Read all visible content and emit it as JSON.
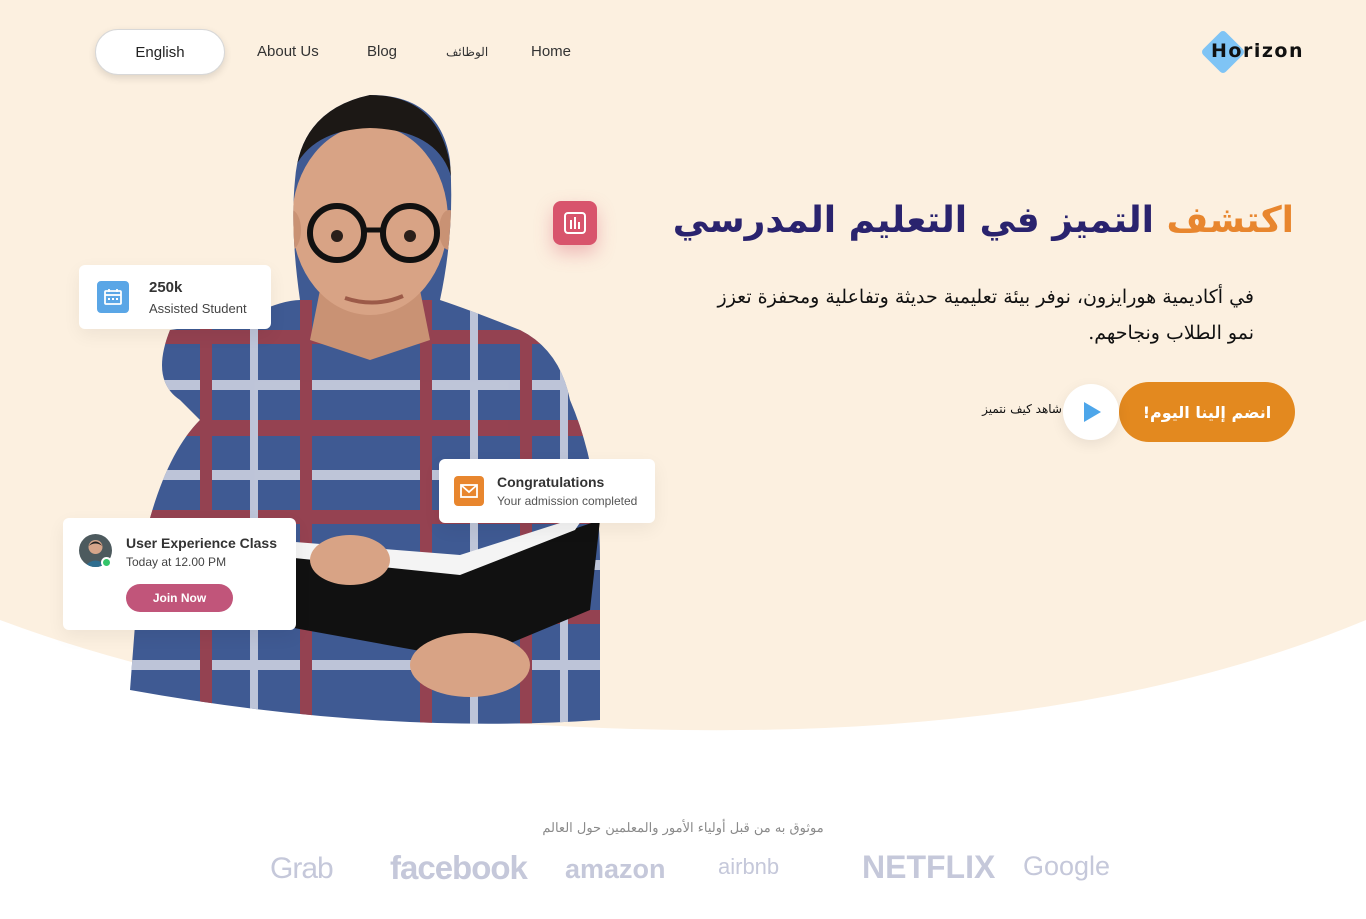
{
  "nav": {
    "language_button": "English",
    "links": [
      "About Us",
      "Blog",
      "الوظائف",
      "Home"
    ],
    "logo_text": "Horizon"
  },
  "hero": {
    "headline_accent": "اكتشف",
    "headline_rest": "التميز في التعليم المدرسي",
    "description": "في أكاديمية هورايزون، نوفر بيئة تعليمية حديثة وتفاعلية ومحفزة تعزز نمو الطلاب ونجاحهم.",
    "cta_button": "انضم إلينا اليوم!",
    "watch_text": "شاهد كيف نتميز"
  },
  "cards": {
    "students": {
      "count": "250k",
      "label": "Assisted Student"
    },
    "congrats": {
      "title": "Congratulations",
      "subtitle": "Your admission completed"
    },
    "class": {
      "title": "User Experience Class",
      "time": "Today at 12.00 PM",
      "button": "Join Now"
    }
  },
  "trusted": {
    "text": "موثوق به من قبل أولياء الأمور والمعلمين حول العالم",
    "brands": [
      "Grab",
      "facebook",
      "amazon",
      "airbnb",
      "NETFLIX",
      "Google"
    ]
  },
  "colors": {
    "hero_bg": "#fcf0e0",
    "headline": "#2a236e",
    "accent": "#e8862e",
    "cta": "#e3891f",
    "join": "#c1557a",
    "chart_badge": "#d8546c",
    "logo_diamond": "#7fc4f5"
  },
  "icons": [
    "calendar-icon",
    "mail-icon",
    "chart-icon",
    "play-icon",
    "logo-diamond-icon"
  ]
}
